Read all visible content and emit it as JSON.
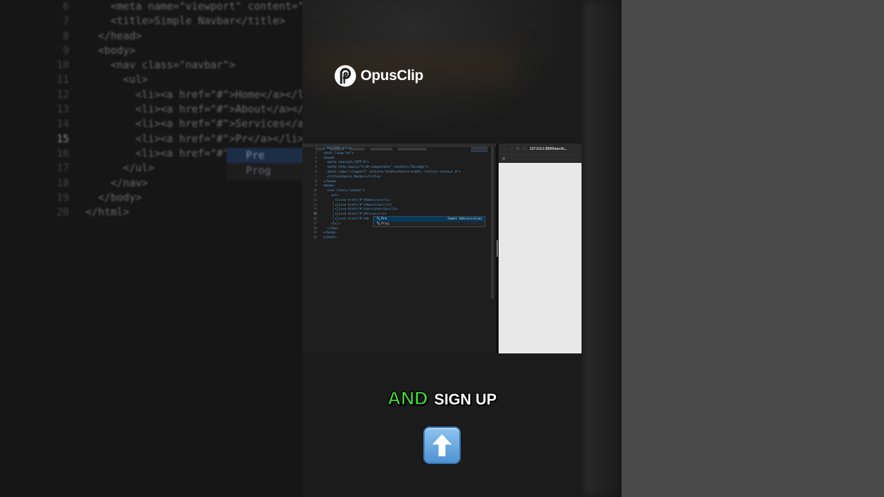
{
  "brand": {
    "name": "OpusClip"
  },
  "background_code": {
    "lines": [
      {
        "n": "6",
        "t": "    <meta name=\"viewport\" content=\"widt"
      },
      {
        "n": "7",
        "t": "    <title>Simple Navbar</title>"
      },
      {
        "n": "8",
        "t": "  </head>"
      },
      {
        "n": "9",
        "t": "  <body>"
      },
      {
        "n": "10",
        "t": "    <nav class=\"navbar\">"
      },
      {
        "n": "11",
        "t": "      <ul>"
      },
      {
        "n": "12",
        "t": "        <li><a href=\"#\">Home</a></li>"
      },
      {
        "n": "13",
        "t": "        <li><a href=\"#\">About</a></li>"
      },
      {
        "n": "14",
        "t": "        <li><a href=\"#\">Services</a></l"
      },
      {
        "n": "15",
        "t": "        <li><a href=\"#\">Pr</a></li>"
      },
      {
        "n": "16",
        "t": "        <li><a href=\"#\">Ho"
      },
      {
        "n": "17",
        "t": "      </ul>"
      },
      {
        "n": "18",
        "t": "    </nav>"
      },
      {
        "n": "19",
        "t": "  </body>"
      },
      {
        "n": "20",
        "t": "</html>"
      }
    ],
    "suggestions": [
      "Pre",
      "Prog"
    ]
  },
  "editor": {
    "lines": [
      {
        "n": "1",
        "t": "<!DOCTYPE html>"
      },
      {
        "n": "2",
        "t": "<html lang=\"en\">"
      },
      {
        "n": "3",
        "t": "<head>"
      },
      {
        "n": "4",
        "t": "  <meta charset=\"UTF-8\">"
      },
      {
        "n": "5",
        "t": "  <meta http-equiv=\"X-UA-Compatible\" content=\"IE=edge\">"
      },
      {
        "n": "6",
        "t": "  <meta name=\"viewport\" content=\"width=device-width, initial-scale=1.0\">"
      },
      {
        "n": "7",
        "t": "  <title>Simple Navbar</title>"
      },
      {
        "n": "8",
        "t": "</head>"
      },
      {
        "n": "9",
        "t": "<body>"
      },
      {
        "n": "10",
        "t": "  <nav class=\"navbar\">"
      },
      {
        "n": "11",
        "t": "    <ul>"
      },
      {
        "n": "12",
        "t": "      <li><a href=\"#\">Home</a></li>"
      },
      {
        "n": "13",
        "t": "      <li><a href=\"#\">About</a></li>"
      },
      {
        "n": "14",
        "t": "      <li><a href=\"#\">Services</a></li>"
      },
      {
        "n": "15",
        "t": "      <li><a href=\"#\">Pr</a></li>"
      },
      {
        "n": "16",
        "t": "      <li><a href=\"#\">Ho"
      },
      {
        "n": "17",
        "t": "    </ul>"
      },
      {
        "n": "18",
        "t": "  </nav>"
      },
      {
        "n": "19",
        "t": "</body>"
      },
      {
        "n": "20",
        "t": "</html>"
      }
    ],
    "active_line": "15",
    "suggest": [
      {
        "label": "Pre",
        "detail": "Emmet Abbreviation"
      },
      {
        "label": "Prog",
        "detail": ""
      }
    ]
  },
  "browser": {
    "url": "127.0.0.1:5500/nav.ht..."
  },
  "caption": {
    "highlight": "AND",
    "rest": "SIGN UP"
  },
  "colors": {
    "highlight": "#3ee233",
    "caption": "#ffffff",
    "arrow_emoji": "#5b9fdc"
  },
  "icons": {
    "logo": "opusclip-logo-icon",
    "emoji": "up-arrow-emoji-icon"
  }
}
